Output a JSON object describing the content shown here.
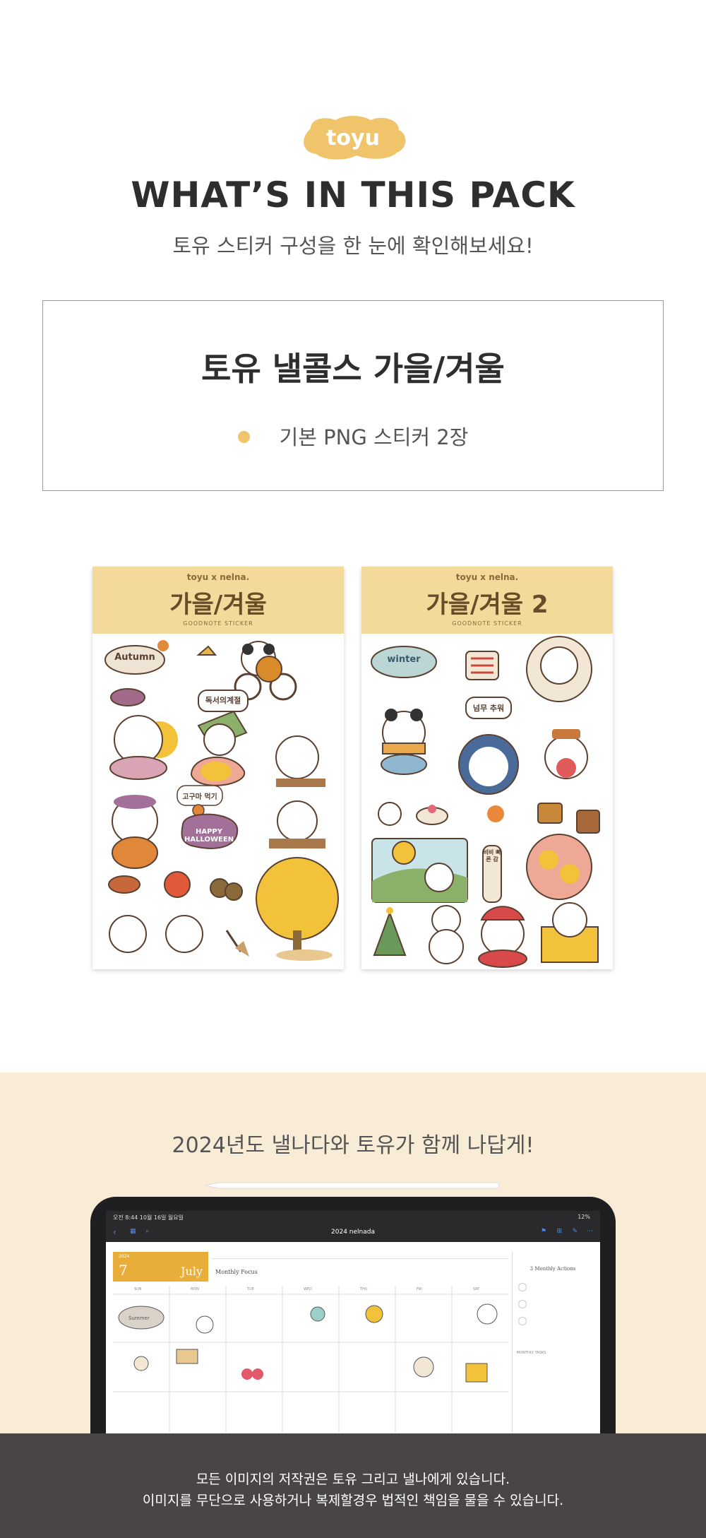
{
  "brand": {
    "logo_text": "toyu"
  },
  "header": {
    "headline": "WHAT’S IN THIS PACK",
    "subline": "토유 스티커 구성을 한 눈에 확인해보세요!"
  },
  "pack": {
    "title": "토유 낼콜스 가을/겨울",
    "items": [
      {
        "label": "기본 PNG 스티커 2장"
      }
    ],
    "dot_color": "#efc46a"
  },
  "sheets": [
    {
      "brand": "toyu x nelna.",
      "title": "가을/겨울",
      "subtitle": "GOODNOTE STICKER",
      "labels": [
        "Autumn",
        "독서의계절",
        "고구마 먹기",
        "HAPPY HALLOWEEN"
      ]
    },
    {
      "brand": "toyu x nelna.",
      "title": "가을/겨울 2",
      "subtitle": "GOODNOTE STICKER",
      "labels": [
        "winter",
        "넘무 추워",
        "비비 빠른 감"
      ]
    }
  ],
  "promo": {
    "title": "2024년도 낼나다와 토유가 함께 나답게!",
    "screen": {
      "status_left": "오전 8:44   10월 16일 월요일",
      "status_right": "12%",
      "doc_title": "2024 nelnada",
      "month_num": "7",
      "month_name": "July",
      "year": "2024",
      "focus_label": "Monthly Focus",
      "side_title": "3 Monthly Actions",
      "side_tasks": "MONTHLY TASKS",
      "weekdays": [
        "SUN",
        "MON",
        "TUE",
        "WED",
        "THU",
        "FRI",
        "SAT"
      ],
      "sticker_word": "Summer"
    }
  },
  "footer": {
    "line1": "모든 이미지의 저작권은 토유 그리고 낼나에게 있습니다.",
    "line2": "이미지를 무단으로 사용하거나 복제할경우 법적인 책임을 물을 수 있습니다."
  },
  "colors": {
    "accent": "#efc46a",
    "sheet_header": "#f3d99a",
    "band_bg": "#f8ecd6",
    "footer_bg": "#4a4545",
    "calendar_accent": "#e9ad3a"
  }
}
